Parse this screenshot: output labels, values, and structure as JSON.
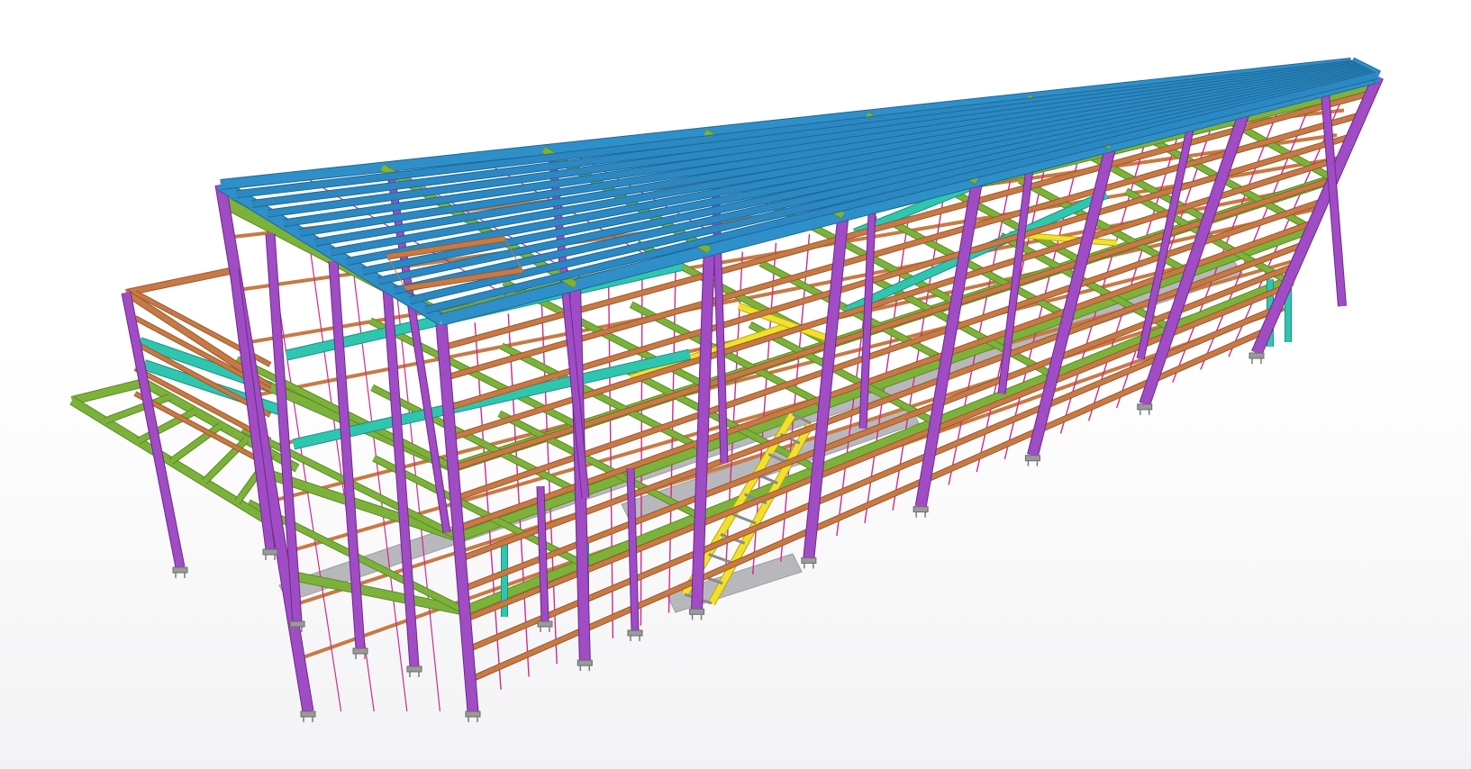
{
  "viewport": {
    "view_name": "3D model view",
    "member_colors": {
      "column": "#a04cc4",
      "column_edge": "#6e2a8e",
      "roof_rafter": "#2f8fc9",
      "purlin": "#2b88c2",
      "primary_beam": "#7db23a",
      "primary_beam_dark": "#5a8a25",
      "secondary_beam": "#2fc6b0",
      "girt": "#c87a44",
      "girt_dark": "#9a5830",
      "tie_rod": "#d12a8a",
      "stair": "#f2e12a",
      "grating": "#b8b8bc",
      "base_plate": "#9a9a9a"
    }
  }
}
